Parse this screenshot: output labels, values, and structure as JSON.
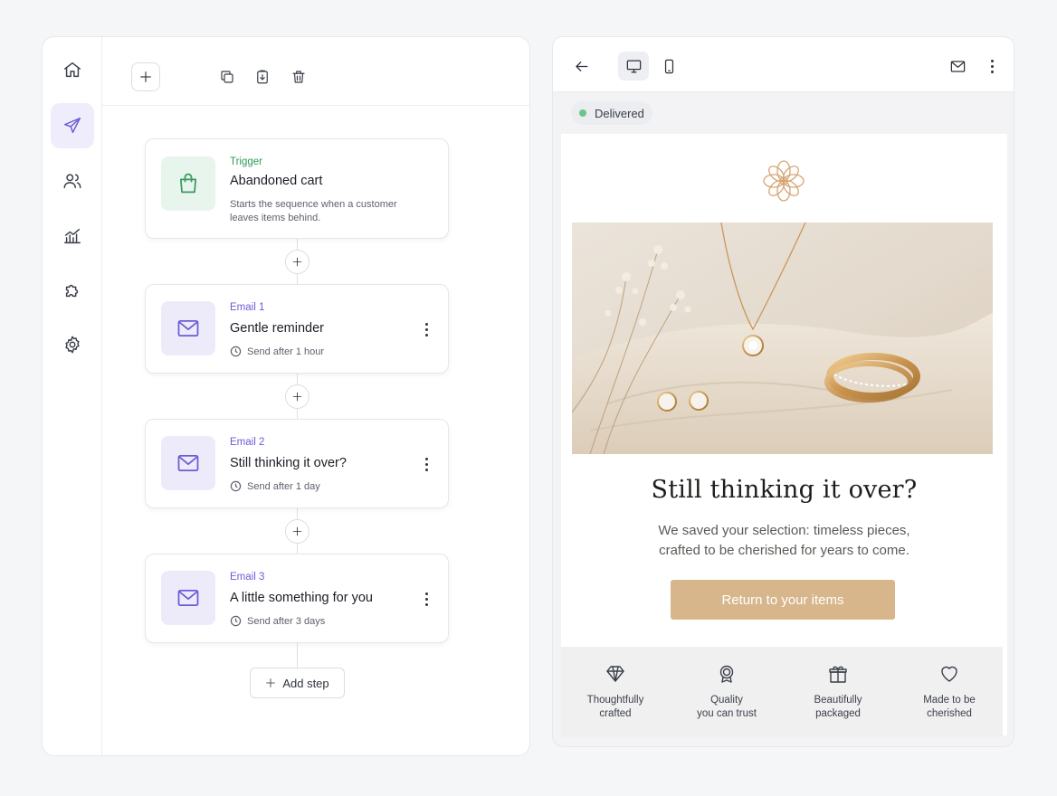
{
  "sidebar": {
    "items": [
      {
        "name": "home",
        "icon": "home-icon"
      },
      {
        "name": "campaigns",
        "icon": "paper-plane-icon",
        "active": true
      },
      {
        "name": "audience",
        "icon": "users-icon"
      },
      {
        "name": "analytics",
        "icon": "chart-icon"
      },
      {
        "name": "integrations",
        "icon": "puzzle-icon"
      },
      {
        "name": "settings",
        "icon": "gear-icon"
      }
    ]
  },
  "toolbar": {
    "actions": [
      "plus-icon",
      "copy-icon",
      "paste-icon",
      "trash-icon"
    ]
  },
  "flow": {
    "trigger": {
      "kicker": "Trigger",
      "title": "Abandoned cart",
      "description": "Starts the sequence when a customer leaves items behind.",
      "icon": "shopping-bag-icon"
    },
    "steps": [
      {
        "kicker": "Email 1",
        "title": "Gentle reminder",
        "delay": "Send after 1 hour",
        "icon": "mail-icon"
      },
      {
        "kicker": "Email 2",
        "title": "Still thinking it over?",
        "delay": "Send after 1 day",
        "icon": "mail-icon"
      },
      {
        "kicker": "Email 3",
        "title": "A little something for you",
        "delay": "Send after 3 days",
        "icon": "mail-icon"
      }
    ],
    "add_step_label": "Add step"
  },
  "preview": {
    "header": {
      "back_icon": "arrow-left-icon",
      "desktop_icon": "desktop-icon",
      "mobile_icon": "mobile-icon",
      "mail_icon": "mail-icon",
      "view_mode": "desktop"
    },
    "status": "Delivered",
    "email": {
      "headline": "Still thinking it over?",
      "subcopy_line1": "We saved your selection: timeless pieces,",
      "subcopy_line2": "crafted to be cherished for years to come.",
      "cta_label": "Return to your items",
      "features": [
        {
          "icon": "diamond-icon",
          "label": "Thoughtfully\ncrafted"
        },
        {
          "icon": "award-icon",
          "label": "Quality\nyou can trust"
        },
        {
          "icon": "gift-icon",
          "label": "Beautifully\npackaged"
        },
        {
          "icon": "heart-icon",
          "label": "Made to be\ncherished"
        }
      ]
    }
  },
  "colors": {
    "accent": "#6a5cd6",
    "trigger_green": "#2f9a55",
    "cta": "#d8b68c",
    "status_dot": "#6cc48a"
  }
}
